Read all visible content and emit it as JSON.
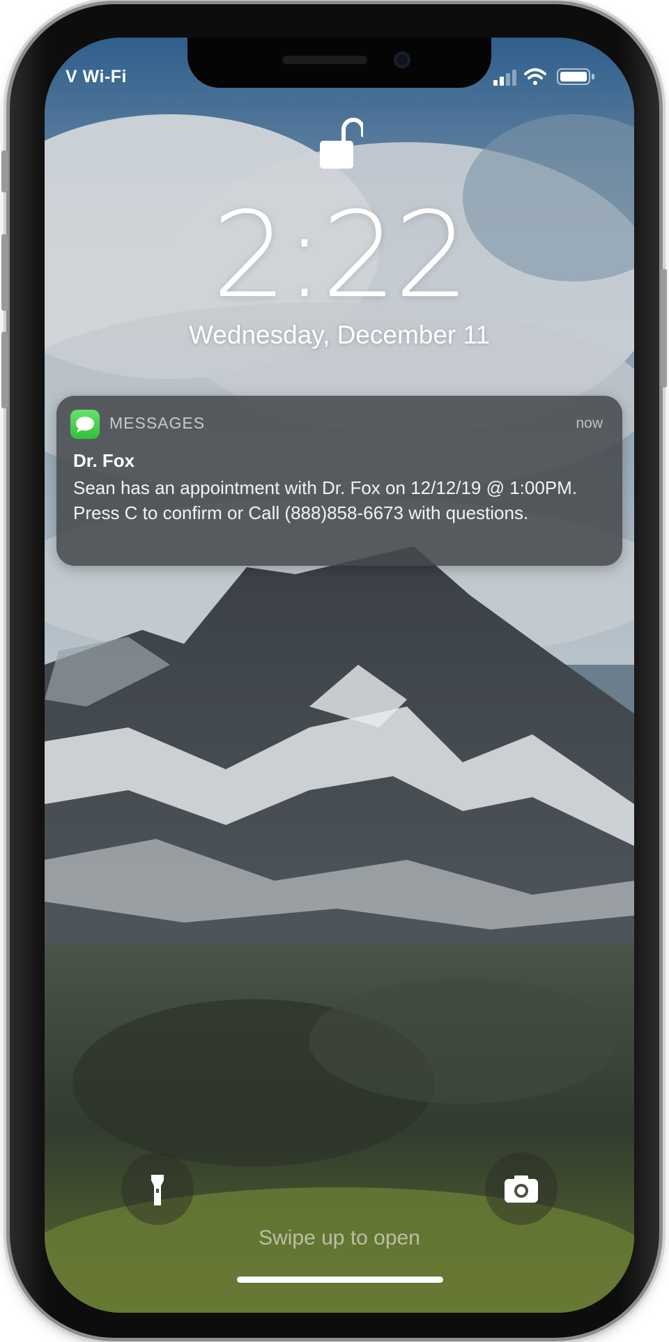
{
  "status_bar": {
    "carrier": "V Wi-Fi",
    "icons": [
      "cellular-signal-icon",
      "wifi-icon",
      "battery-icon"
    ]
  },
  "lock_screen": {
    "lock_state": "unlocked",
    "time": "2:22",
    "date": "Wednesday, December 11",
    "swipe_hint": "Swipe up to open"
  },
  "notification": {
    "app_name": "MESSAGES",
    "app_icon": "messages-icon",
    "time": "now",
    "title": "Dr. Fox",
    "body": "Sean has an appointment with Dr. Fox on 12/12/19 @ 1:00PM. Press C to confirm or Call (888)858-6673 with questions."
  },
  "quick_actions": {
    "left": "flashlight-icon",
    "right": "camera-icon"
  },
  "colors": {
    "messages_green": "#34c759",
    "notification_bg": "#46484c"
  }
}
